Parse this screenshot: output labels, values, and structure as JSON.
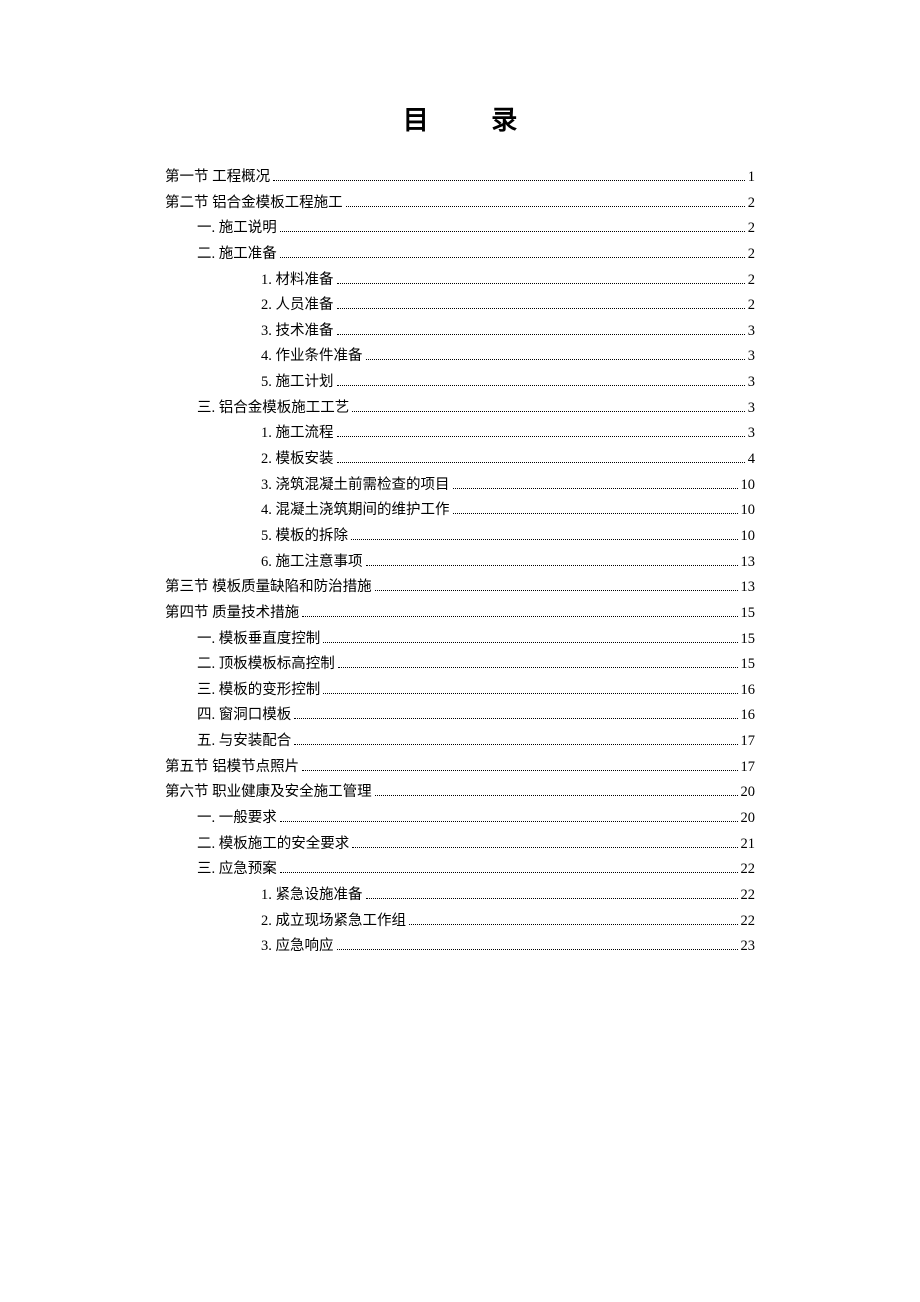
{
  "title": "目 录",
  "entries": [
    {
      "level": 0,
      "label": "第一节  工程概况",
      "page": "1"
    },
    {
      "level": 0,
      "label": "第二节  铝合金模板工程施工",
      "page": "2"
    },
    {
      "level": 1,
      "label": "一.  施工说明",
      "page": "2"
    },
    {
      "level": 1,
      "label": "二.  施工准备",
      "page": "2"
    },
    {
      "level": 2,
      "label": "1.  材料准备",
      "page": "2"
    },
    {
      "level": 2,
      "label": "2.  人员准备",
      "page": "2"
    },
    {
      "level": 2,
      "label": "3.  技术准备",
      "page": "3"
    },
    {
      "level": 2,
      "label": "4.  作业条件准备",
      "page": "3"
    },
    {
      "level": 2,
      "label": "5.  施工计划",
      "page": "3"
    },
    {
      "level": 1,
      "label": "三.  铝合金模板施工工艺",
      "page": "3"
    },
    {
      "level": 2,
      "label": "1.  施工流程",
      "page": "3"
    },
    {
      "level": 2,
      "label": "2.  模板安装",
      "page": "4"
    },
    {
      "level": 2,
      "label": "3.  浇筑混凝土前需检查的项目",
      "page": "10"
    },
    {
      "level": 2,
      "label": "4.  混凝土浇筑期间的维护工作",
      "page": "10"
    },
    {
      "level": 2,
      "label": "5.  模板的拆除",
      "page": "10"
    },
    {
      "level": 2,
      "label": "6.  施工注意事项",
      "page": "13"
    },
    {
      "level": 0,
      "label": "第三节  模板质量缺陷和防治措施",
      "page": "13"
    },
    {
      "level": 0,
      "label": "第四节  质量技术措施",
      "page": "15"
    },
    {
      "level": 1,
      "label": "一.  模板垂直度控制",
      "page": "15"
    },
    {
      "level": 1,
      "label": "二.  顶板模板标高控制",
      "page": "15"
    },
    {
      "level": 1,
      "label": "三.  模板的变形控制",
      "page": "16"
    },
    {
      "level": 1,
      "label": "四.  窗洞口模板",
      "page": "16"
    },
    {
      "level": 1,
      "label": "五.  与安装配合",
      "page": "17"
    },
    {
      "level": 0,
      "label": "第五节  铝模节点照片",
      "page": "17"
    },
    {
      "level": 0,
      "label": "第六节  职业健康及安全施工管理",
      "page": "20"
    },
    {
      "level": 1,
      "label": "一.  一般要求",
      "page": "20"
    },
    {
      "level": 1,
      "label": "二.  模板施工的安全要求",
      "page": "21"
    },
    {
      "level": 1,
      "label": "三.  应急预案",
      "page": "22"
    },
    {
      "level": 2,
      "label": "1.  紧急设施准备",
      "page": "22"
    },
    {
      "level": 2,
      "label": "2.  成立现场紧急工作组",
      "page": "22"
    },
    {
      "level": 2,
      "label": "3.  应急响应",
      "page": "23"
    }
  ]
}
